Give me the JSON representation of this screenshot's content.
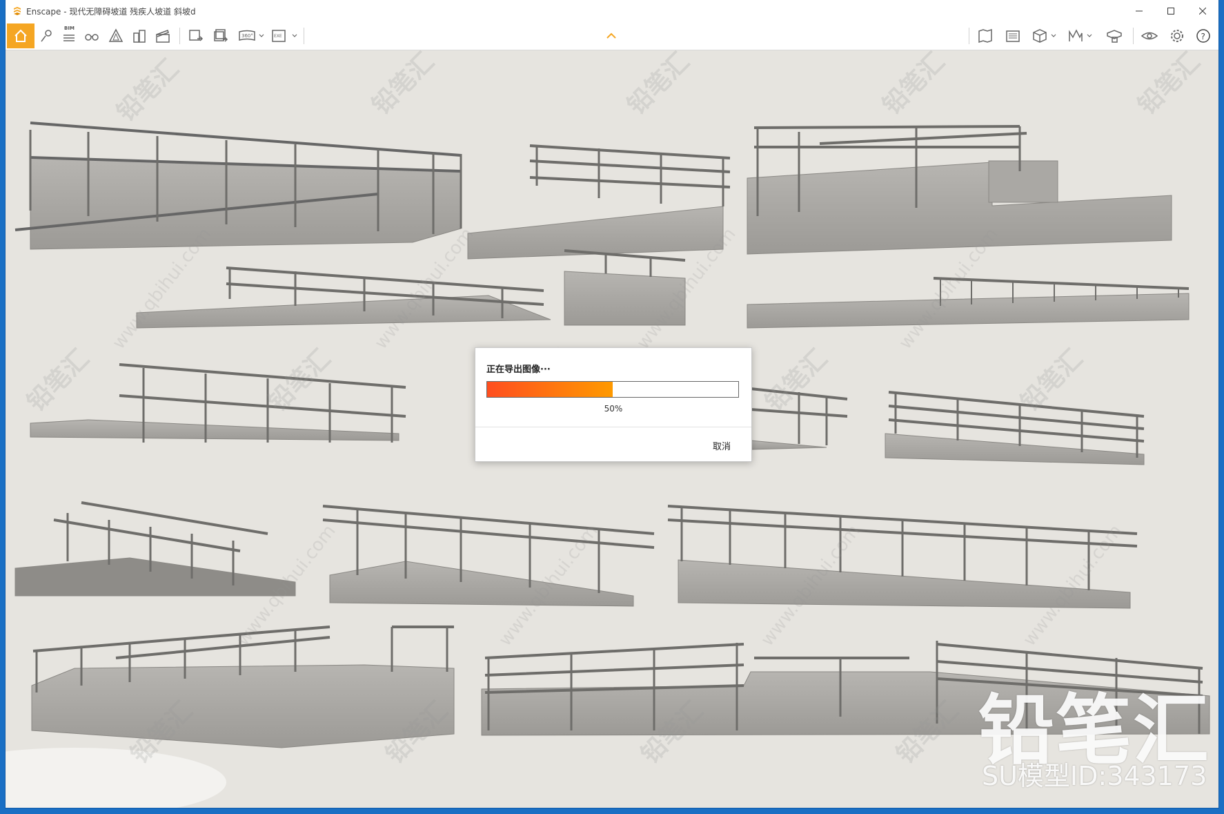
{
  "window": {
    "app_name": "Enscape",
    "title": "Enscape - 现代无障碍坡道 残疾人坡道 斜坡d"
  },
  "dialog": {
    "title": "正在导出图像···",
    "progress": 0.5,
    "progress_label": "50%",
    "cancel_label": "取消"
  },
  "toolbar": {
    "bim_label": "BIM",
    "icons": [
      "home-icon",
      "location-pin-icon",
      "bim-list-icon",
      "binoculars-icon",
      "perspective-icon",
      "buildings-icon",
      "clapper-icon",
      "screenshot-export-icon",
      "batch-export-icon",
      "panorama-360-icon",
      "exe-export-icon",
      "map-icon",
      "atlas-icon",
      "cube-icon",
      "asset-library-icon",
      "material-icon",
      "visual-settings-icon",
      "settings-gear-icon",
      "help-icon"
    ],
    "pano_label": "360°",
    "exe_label": "EXE"
  },
  "watermark": {
    "text": "铅笔汇",
    "url": "www.qbihui.com",
    "brand": "铅笔汇",
    "model_id": "SU模型ID:343173"
  },
  "colors": {
    "accent": "#f5a623",
    "progress_start": "#ff4e1f",
    "progress_end": "#ff9a00",
    "background": "#e6e4df"
  }
}
